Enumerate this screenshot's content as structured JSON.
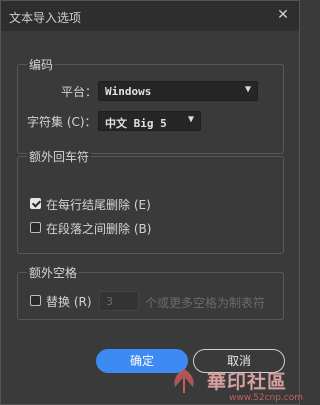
{
  "window": {
    "title": "文本导入选项"
  },
  "encoding": {
    "legend": "编码",
    "platform_label": "平台：",
    "platform_value": "Windows",
    "charset_label": "字符集 (C)：",
    "charset_value": "中文 Big 5"
  },
  "extra_returns": {
    "legend": "额外回车符",
    "remove_eol": {
      "label": "在每行结尾删除 (E)",
      "checked": true
    },
    "remove_between": {
      "label": "在段落之间删除 (B)",
      "checked": false
    }
  },
  "extra_spaces": {
    "legend": "额外空格",
    "replace_label": "替换 (R)",
    "replace_checked": false,
    "count_value": "3",
    "suffix": "个或更多空格为制表符"
  },
  "buttons": {
    "ok": "确定",
    "cancel": "取消"
  },
  "watermark": {
    "text": "華印社區",
    "url": "www.52cnp.com"
  },
  "colors": {
    "accent": "#3d8bf2",
    "background": "#3a3a3a"
  }
}
